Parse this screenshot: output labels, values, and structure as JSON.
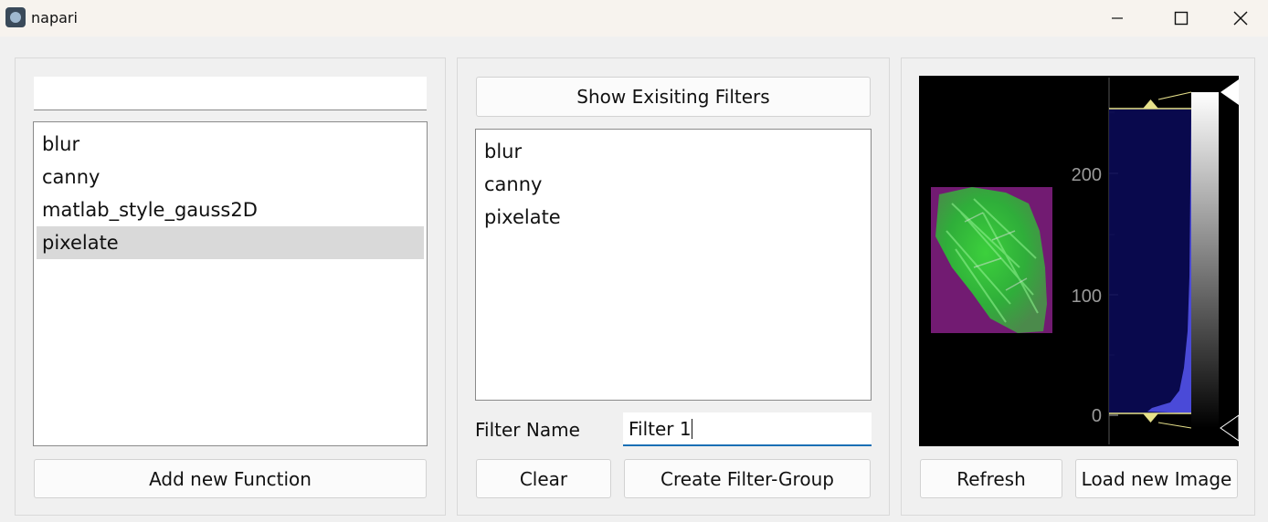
{
  "window": {
    "title": "napari"
  },
  "function_panel": {
    "search_value": "",
    "items": [
      {
        "label": "blur"
      },
      {
        "label": "canny"
      },
      {
        "label": "matlab_style_gauss2D"
      },
      {
        "label": "pixelate"
      }
    ],
    "selected_index": 3,
    "add_button": "Add new Function"
  },
  "filter_panel": {
    "show_button": "Show Exisiting Filters",
    "items": [
      {
        "label": "blur"
      },
      {
        "label": "canny"
      },
      {
        "label": "pixelate"
      }
    ],
    "filter_name_label": "Filter Name",
    "filter_name_value": "Filter 1",
    "clear_button": "Clear",
    "create_button": "Create Filter-Group"
  },
  "image_panel": {
    "histogram_ticks": [
      "200",
      "100",
      "0"
    ],
    "refresh_button": "Refresh",
    "load_button": "Load new Image"
  },
  "colors": {
    "accent": "#1a6fb5",
    "histogram_fill": "#4a4ad8",
    "histogram_bg": "#0a0a55",
    "level_marker": "#e6e08a"
  },
  "icons": [
    "napari-app-icon",
    "minimize-icon",
    "maximize-icon",
    "close-icon"
  ]
}
